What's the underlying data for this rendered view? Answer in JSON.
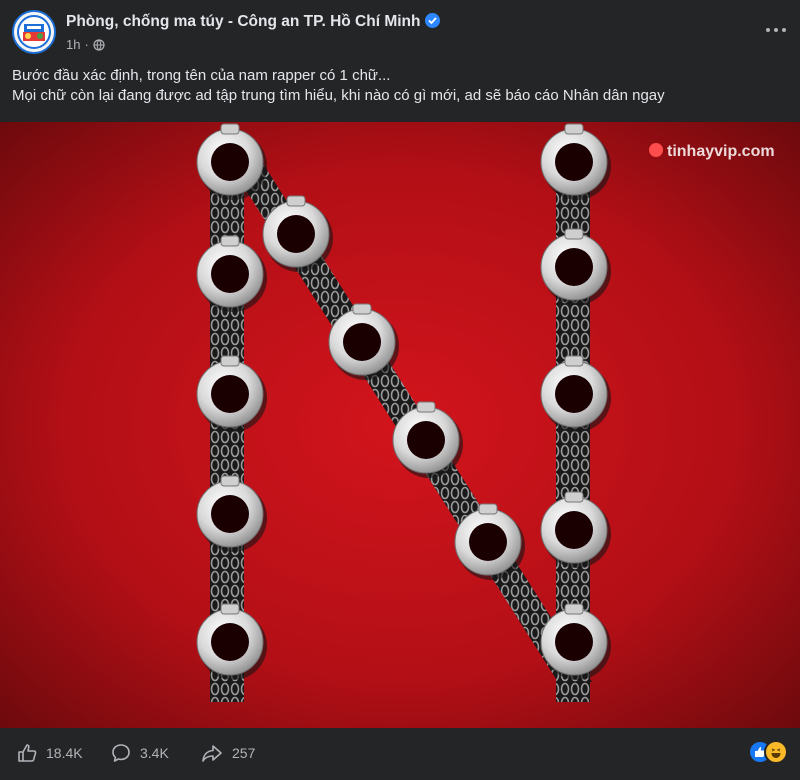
{
  "post": {
    "page_name": "Phòng, chống ma túy - Công an TP. Hồ Chí Minh",
    "time": "1h",
    "separator": "·",
    "text_lines": [
      "Bước đầu xác định, trong tên của nam rapper có 1 chữ...",
      "Mọi chữ còn lại đang được ad tập trung tìm hiểu, khi nào có gì mới, ad sẽ báo cáo Nhân dân ngay"
    ],
    "watermark": "tinhayvip.com"
  },
  "stats": {
    "likes": "18.4K",
    "comments": "3.4K",
    "shares": "257"
  },
  "icons": {
    "verified": "verified-badge-icon",
    "privacy": "globe-icon",
    "more": "more-options-icon",
    "like": "like-icon",
    "comment": "comment-icon",
    "share": "share-icon",
    "reactions": [
      "like-reaction-icon",
      "haha-reaction-icon"
    ]
  },
  "colors": {
    "background": "#242526",
    "image_red": "#c8101a",
    "verified_blue": "#2d88ff"
  }
}
